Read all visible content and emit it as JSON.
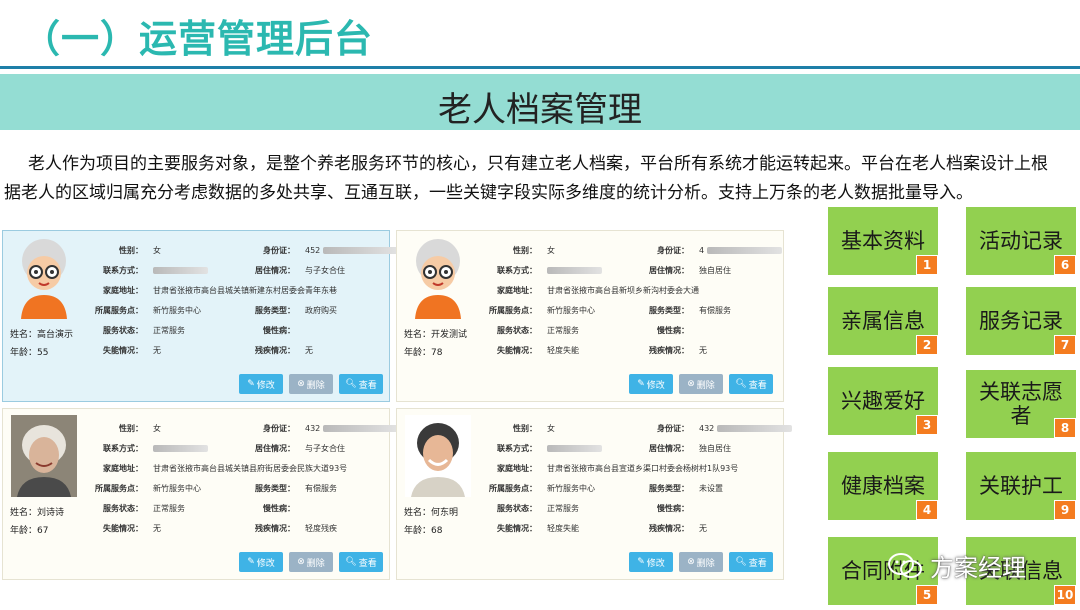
{
  "section_title": "（一）运营管理后台",
  "banner_title": "老人档案管理",
  "intro": "老人作为项目的主要服务对象，是整个养老服务环节的核心，只有建立老人档案，平台所有系统才能运转起来。平台在老人档案设计上根据老人的区域归属充分考虑数据的多处共享、互通互联，一些关键字段实际多维度的统计分析。支持上万条的老人数据批量导入。",
  "labels": {
    "gender": "性别：",
    "id": "身份证：",
    "contact": "联系方式：",
    "living": "居住情况：",
    "address": "家庭地址：",
    "service_point": "所属服务点：",
    "service_type": "服务类型：",
    "service_status": "服务状态：",
    "chronic": "慢性病：",
    "disability_loss": "失能情况：",
    "disability": "残疾情况：",
    "edit": "修改",
    "delete": "删除",
    "view": "查看"
  },
  "cards": [
    {
      "name": "姓名：高台演示",
      "age": "年龄：55",
      "gender": "女",
      "id": "452",
      "living": "与子女合住",
      "address": "甘肃省张掖市高台县城关镇新建东村居委会青年东巷",
      "service_point": "新竹服务中心",
      "service_type": "政府购买",
      "service_status": "正常服务",
      "chronic": "",
      "disability_loss": "无",
      "disability": "无"
    },
    {
      "name": "姓名：开发测试",
      "age": "年龄：78",
      "gender": "女",
      "id": "4",
      "living": "独自居住",
      "address": "甘肃省张掖市高台县新坝乡新沟村委会大通",
      "service_point": "新竹服务中心",
      "service_type": "有偿服务",
      "service_status": "正常服务",
      "chronic": "",
      "disability_loss": "轻度失能",
      "disability": "无"
    },
    {
      "name": "姓名：刘诗诗",
      "age": "年龄：67",
      "gender": "女",
      "id": "432",
      "living": "与子女合住",
      "address": "甘肃省张掖市高台县城关镇县府街居委会民族大道93号",
      "service_point": "新竹服务中心",
      "service_type": "有偿服务",
      "service_status": "正常服务",
      "chronic": "",
      "disability_loss": "无",
      "disability": "轻度残疾"
    },
    {
      "name": "姓名：何东明",
      "age": "年龄：68",
      "gender": "女",
      "id": "432",
      "living": "独自居住",
      "address": "甘肃省张掖市高台县宣道乡渠口村委会杨树村1队93号",
      "service_point": "新竹服务中心",
      "service_type": "未设置",
      "service_status": "正常服务",
      "chronic": "",
      "disability_loss": "轻度失能",
      "disability": "无"
    }
  ],
  "modules": [
    {
      "label": "基本资料",
      "num": "1"
    },
    {
      "label": "亲属信息",
      "num": "2"
    },
    {
      "label": "兴趣爱好",
      "num": "3"
    },
    {
      "label": "健康档案",
      "num": "4"
    },
    {
      "label": "合同附件",
      "num": "5"
    },
    {
      "label": "活动记录",
      "num": "6"
    },
    {
      "label": "服务记录",
      "num": "7"
    },
    {
      "label": "关联志愿者",
      "num": "8"
    },
    {
      "label": "关联护工",
      "num": "9"
    },
    {
      "label": "关联信息",
      "num": "10"
    }
  ],
  "watermark": "方案经理",
  "colors": {
    "accent": "#2bb8b0",
    "banner": "#94ddd3",
    "tile": "#92d050",
    "badge": "#f47c20",
    "button": "#3fb3e6"
  }
}
